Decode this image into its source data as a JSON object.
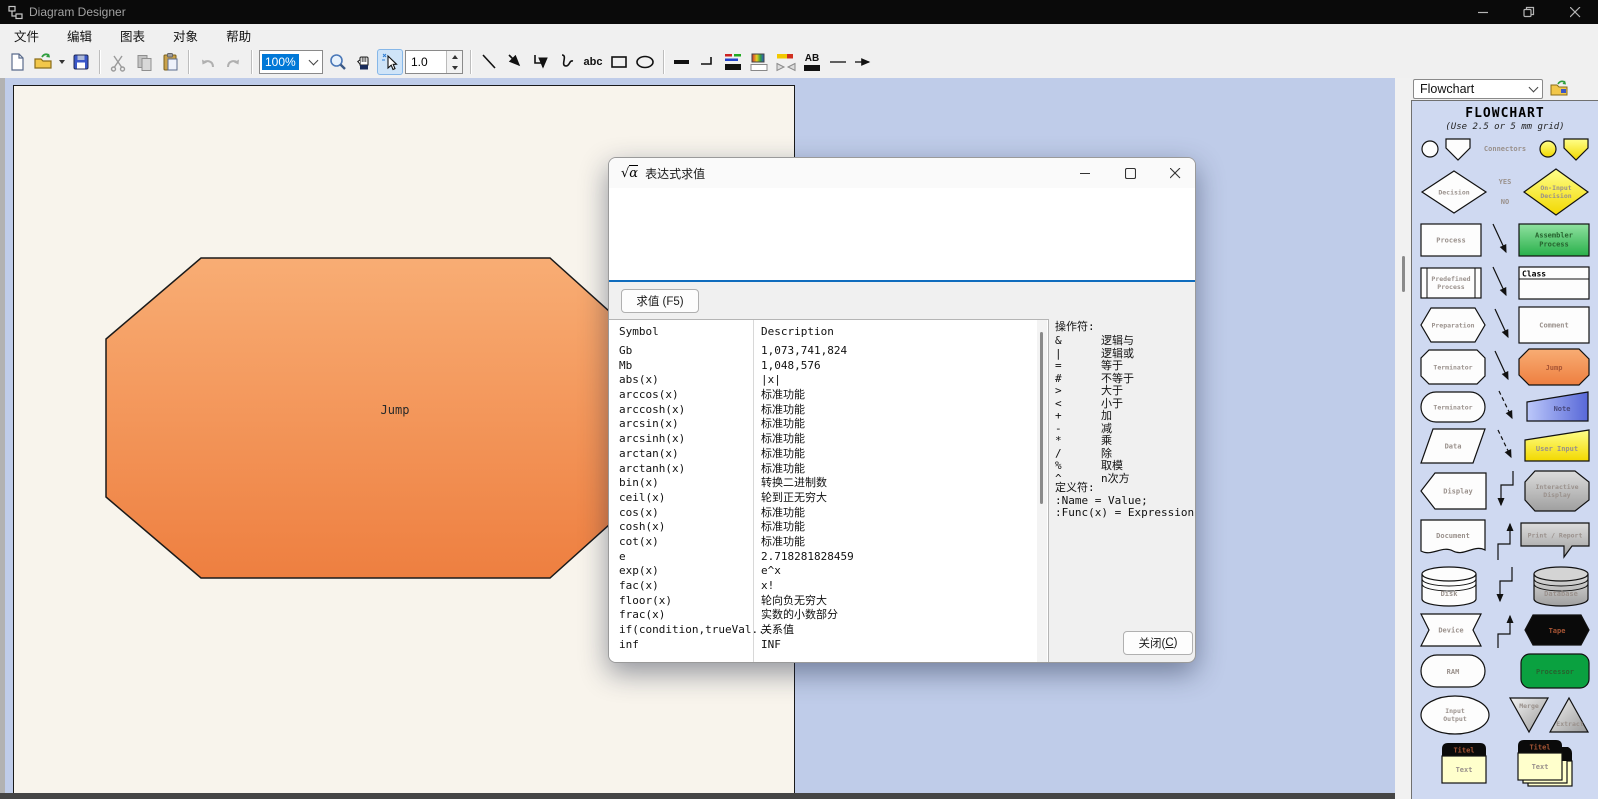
{
  "window": {
    "title": "Diagram Designer"
  },
  "menu": {
    "items": [
      "文件",
      "编辑",
      "图表",
      "对象",
      "帮助"
    ]
  },
  "toolbar": {
    "zoom": "100%",
    "width_value": "1.0",
    "text_tool": "abc",
    "ab": "AB"
  },
  "canvas": {
    "jump_label": "Jump"
  },
  "dialog": {
    "title": "表达式求值",
    "icon": {
      "sqrt": "√",
      "alpha": "α"
    },
    "eval_button": "求值 (F5)",
    "close_button": {
      "pre": "关闭(",
      "key": "C",
      "post": ")"
    },
    "table": {
      "col1": "Symbol",
      "col2": "Description",
      "rows": [
        {
          "s": "Gb",
          "d": "1,073,741,824"
        },
        {
          "s": "Mb",
          "d": "1,048,576"
        },
        {
          "s": "abs(x)",
          "d": "|x|"
        },
        {
          "s": "arccos(x)",
          "d": "标准功能"
        },
        {
          "s": "arccosh(x)",
          "d": "标准功能"
        },
        {
          "s": "arcsin(x)",
          "d": "标准功能"
        },
        {
          "s": "arcsinh(x)",
          "d": "标准功能"
        },
        {
          "s": "arctan(x)",
          "d": "标准功能"
        },
        {
          "s": "arctanh(x)",
          "d": "标准功能"
        },
        {
          "s": "bin(x)",
          "d": "转换二进制数"
        },
        {
          "s": "ceil(x)",
          "d": "轮到正无穷大"
        },
        {
          "s": "cos(x)",
          "d": "标准功能"
        },
        {
          "s": "cosh(x)",
          "d": "标准功能"
        },
        {
          "s": "cot(x)",
          "d": "标准功能"
        },
        {
          "s": "e",
          "d": "2.718281828459"
        },
        {
          "s": "exp(x)",
          "d": "e^x"
        },
        {
          "s": "fac(x)",
          "d": "x!"
        },
        {
          "s": "floor(x)",
          "d": "轮向负无穷大"
        },
        {
          "s": "frac(x)",
          "d": "实数的小数部分"
        },
        {
          "s": "if(condition,trueVal...",
          "d": "关系值"
        },
        {
          "s": "inf",
          "d": "INF"
        }
      ]
    },
    "operators": {
      "title": "操作符:",
      "items": [
        {
          "s": "&",
          "d": "逻辑与"
        },
        {
          "s": "|",
          "d": "逻辑或"
        },
        {
          "s": "=",
          "d": "等于"
        },
        {
          "s": "#",
          "d": "不等于"
        },
        {
          "s": ">",
          "d": "大于"
        },
        {
          "s": "<",
          "d": "小于"
        },
        {
          "s": "+",
          "d": "加"
        },
        {
          "s": "-",
          "d": "减"
        },
        {
          "s": "*",
          "d": "乘"
        },
        {
          "s": "/",
          "d": "除"
        },
        {
          "s": "%",
          "d": "取模"
        },
        {
          "s": "^",
          "d": "n次方"
        }
      ]
    },
    "definitions": {
      "title": "定义符:",
      "line1": ":Name = Value;",
      "line2": ":Func(x) = Expression;"
    }
  },
  "sidebar": {
    "template": "Flowchart",
    "palette_title": "FLOWCHART",
    "palette_subtitle": "(Use 2.5 or 5 mm grid)",
    "connectors": "Connectors",
    "yes": "YES",
    "no": "NO",
    "shapes": {
      "decision": "Decision",
      "on_input_1": "On-Input",
      "on_input_2": "Decision",
      "process": "Process",
      "assembler_1": "Assembler",
      "assembler_2": "Process",
      "predefined_1": "Predefined",
      "predefined_2": "Process",
      "cls": "Class",
      "preparation": "Preparation",
      "comment": "Comment",
      "terminator": "Terminator",
      "jump": "Jump",
      "terminator2": "Terminator",
      "note": "Note",
      "data": "Data",
      "user_input": "User Input",
      "display": "Display",
      "interactive_1": "Interactive",
      "interactive_2": "Display",
      "document": "Document",
      "print_report": "Print / Report",
      "disk": "Disk",
      "database": "Database",
      "device": "Device",
      "tape": "Tape",
      "ram": "RAM",
      "processor": "Processor",
      "io_1": "Input",
      "io_2": "Output",
      "merge": "Merge",
      "extract": "Extract",
      "titel": "Titel",
      "text": "Text"
    }
  },
  "colors": {
    "accent_blue": "#0f6cbd",
    "selection_blue": "#0078d7",
    "canvas_blue": "#bfcce9",
    "page_cream": "#f8f4ec",
    "shape_orange_top": "#f8ad74",
    "shape_orange_bottom": "#ee7f40",
    "assembler_green": "#28b04a",
    "processor_green": "#0aa140"
  }
}
